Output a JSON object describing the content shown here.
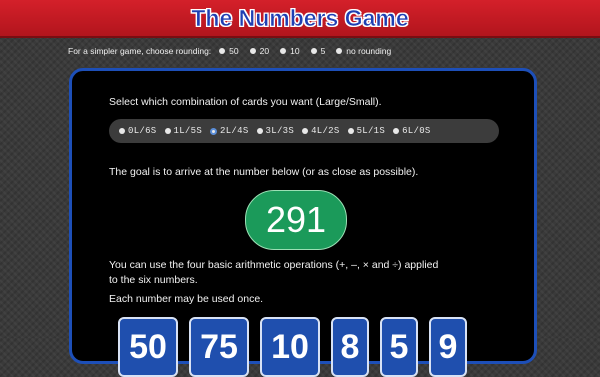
{
  "header": {
    "title": "The Numbers Game"
  },
  "rounding": {
    "label": "For a simpler game, choose rounding:",
    "options": [
      "50",
      "20",
      "10",
      "5",
      "no rounding"
    ]
  },
  "panel": {
    "instruction_cards": "Select which combination of cards you want (Large/Small).",
    "card_options": [
      "0L/6S",
      "1L/5S",
      "2L/4S",
      "3L/3S",
      "4L/2S",
      "5L/1S",
      "6L/0S"
    ],
    "selected_option": "2L/4S",
    "goal_text": "The goal is to arrive at the number below (or as close as possible).",
    "target": "291",
    "ops_line1": "You can use the four basic arithmetic operations (+, –, × and ÷) applied",
    "ops_line2": "to the six numbers.",
    "ops_line3": "Each number may be used once.",
    "numbers": [
      "50",
      "75",
      "10",
      "8",
      "5",
      "9"
    ]
  }
}
